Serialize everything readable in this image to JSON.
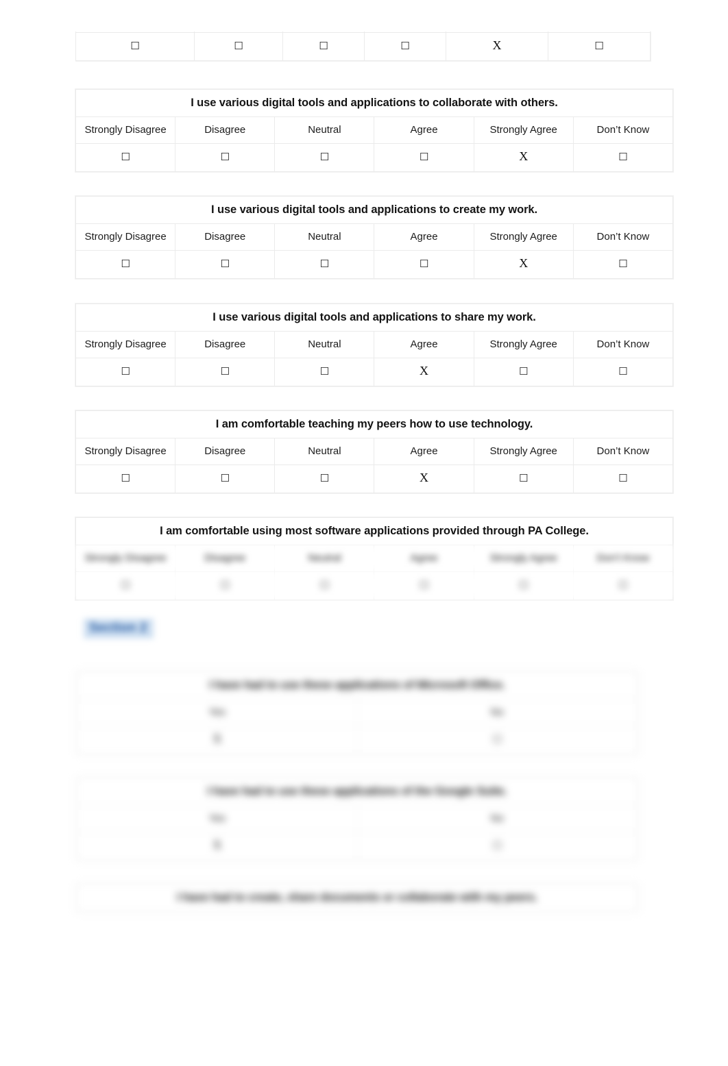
{
  "document": {
    "type": "survey-form",
    "page_background": "#ffffff",
    "accent_highlight": "#cfe0f2",
    "accent_text": "#2b5fa4",
    "border_color": "#ebebeb"
  },
  "glyphs": {
    "checkbox_empty": "☐",
    "checked_mark": "X"
  },
  "likert_options": [
    "Strongly Disagree",
    "Disagree",
    "Neutral",
    "Agree",
    "Strongly Agree",
    "Don’t Know"
  ],
  "yesno_options": [
    "Yes",
    "No"
  ],
  "questions": [
    {
      "id": "q-partial-top",
      "title": "",
      "title_visible": false,
      "options_visible": false,
      "answers": [
        "☐",
        "☐",
        "☐",
        "☐",
        "X",
        "☐"
      ],
      "selected_index": 4,
      "blur": "none"
    },
    {
      "id": "q-collaborate",
      "title": "I use various digital tools and applications to collaborate with others.",
      "title_visible": true,
      "options_visible": true,
      "answers": [
        "☐",
        "☐",
        "☐",
        "☐",
        "X",
        "☐"
      ],
      "selected_index": 4,
      "blur": "none"
    },
    {
      "id": "q-create-work",
      "title": "I use various digital tools and applications to create my work.",
      "title_visible": true,
      "options_visible": true,
      "answers": [
        "☐",
        "☐",
        "☐",
        "☐",
        "X",
        "☐"
      ],
      "selected_index": 4,
      "blur": "none"
    },
    {
      "id": "q-share-work",
      "title": "I use various digital tools and applications to share my work.",
      "title_visible": true,
      "options_visible": true,
      "answers": [
        "☐",
        "☐",
        "☐",
        "X",
        "☐",
        "☐"
      ],
      "selected_index": 3,
      "blur": "none"
    },
    {
      "id": "q-teach-peers",
      "title": "I am comfortable teaching my peers how to use technology.",
      "title_visible": true,
      "options_visible": true,
      "answers": [
        "☐",
        "☐",
        "☐",
        "X",
        "☐",
        "☐"
      ],
      "selected_index": 3,
      "blur": "none"
    },
    {
      "id": "q-pa-college-software",
      "title": "I am comfortable using most software applications provided through PA College.",
      "title_visible": true,
      "options_visible": true,
      "answers": [
        "☐",
        "☐",
        "☐",
        "☐",
        "☐",
        "☐"
      ],
      "selected_index": null,
      "blur": "heavy-rows"
    }
  ],
  "section": {
    "heading": "Section 2",
    "subtext": ""
  },
  "yesno_questions": [
    {
      "id": "q-microsoft-office",
      "title": "I have had to use these applications of Microsoft Office.",
      "answers": [
        "X",
        "☐"
      ],
      "blur": "max"
    },
    {
      "id": "q-google-suite",
      "title": "I have had to use these applications of the Google Suite.",
      "answers": [
        "X",
        "☐"
      ],
      "blur": "max"
    },
    {
      "id": "q-share-documents",
      "title": "I have had to create, share documents or collaborate with my peers.",
      "answers": [],
      "blur": "max",
      "header_only": true
    }
  ]
}
